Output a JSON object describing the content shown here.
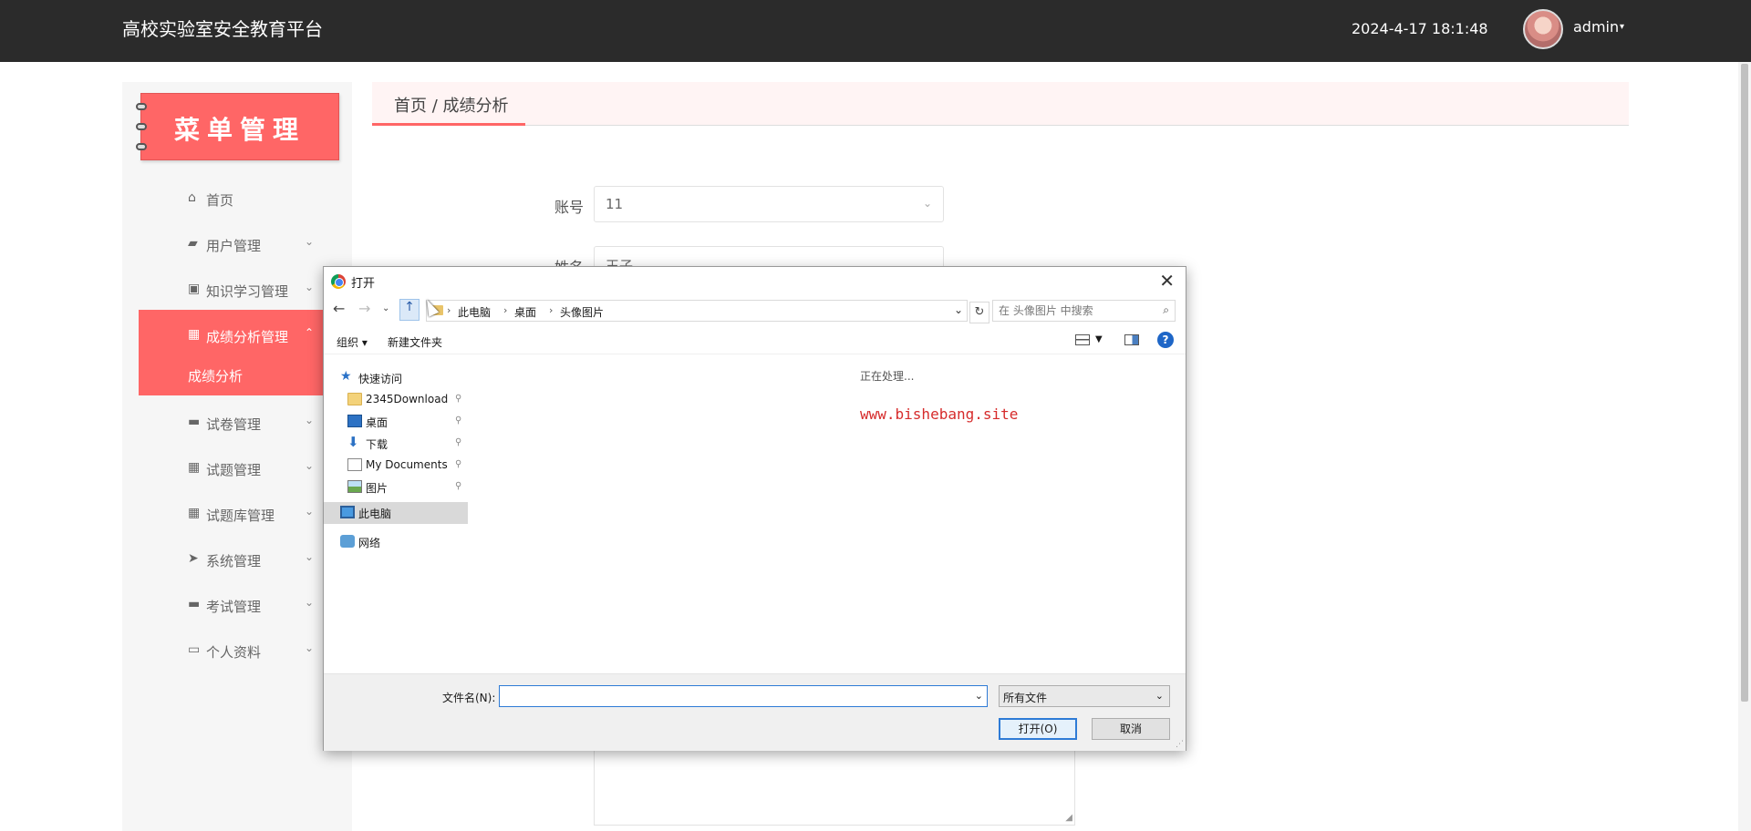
{
  "topbar": {
    "app_title": "高校实验室安全教育平台",
    "clock": "2024-4-17 18:1:48",
    "user_name": "admin",
    "user_caret": "▾"
  },
  "sidebar": {
    "banner": "菜单管理",
    "items": [
      {
        "icon": "home-icon",
        "glyph": "⌂",
        "label": "首页",
        "caret": ""
      },
      {
        "icon": "user-icon",
        "glyph": "▰",
        "label": "用户管理",
        "caret": "⌄"
      },
      {
        "icon": "clipboard-icon",
        "glyph": "▣",
        "label": "知识学习管理",
        "caret": "⌄"
      },
      {
        "icon": "grid-icon",
        "glyph": "▦",
        "label": "成绩分析管理",
        "caret": "⌃",
        "active": true
      },
      {
        "icon": "monitor-icon",
        "glyph": "▬",
        "label": "试卷管理",
        "caret": "⌄"
      },
      {
        "icon": "grid-icon",
        "glyph": "▦",
        "label": "试题管理",
        "caret": "⌄"
      },
      {
        "icon": "grid-icon",
        "glyph": "▦",
        "label": "试题库管理",
        "caret": "⌄"
      },
      {
        "icon": "send-icon",
        "glyph": "➤",
        "label": "系统管理",
        "caret": "⌄"
      },
      {
        "icon": "monitor-icon",
        "glyph": "▬",
        "label": "考试管理",
        "caret": "⌄"
      },
      {
        "icon": "card-icon",
        "glyph": "▭",
        "label": "个人资料",
        "caret": "⌄"
      }
    ],
    "sub_item": "成绩分析"
  },
  "breadcrumb": {
    "text": "首页 / 成绩分析"
  },
  "form": {
    "account_label": "账号",
    "account_value": "11",
    "name_label": "姓名",
    "name_value": "王子"
  },
  "dialog": {
    "title": "打开",
    "close": "✕",
    "path": [
      "此电脑",
      "桌面",
      "头像图片"
    ],
    "search_placeholder": "在 头像图片 中搜索",
    "toolbar": {
      "organize": "组织 ▾",
      "new_folder": "新建文件夹",
      "help": "?"
    },
    "tree": [
      {
        "icon": "star-icon",
        "cls": "star",
        "glyph": "★",
        "label": "快速访问",
        "indent": 22,
        "pinned": false
      },
      {
        "icon": "folder-icon",
        "cls": "folder",
        "glyph": "",
        "label": "2345Download",
        "indent": 30,
        "pinned": true
      },
      {
        "icon": "desktop-icon",
        "cls": "desktop",
        "glyph": "",
        "label": "桌面",
        "indent": 30,
        "pinned": true
      },
      {
        "icon": "download-icon",
        "cls": "download",
        "glyph": "⬇",
        "label": "下载",
        "indent": 30,
        "pinned": true
      },
      {
        "icon": "document-icon",
        "cls": "doc",
        "glyph": "",
        "label": "My Documents",
        "indent": 30,
        "pinned": true
      },
      {
        "icon": "pictures-icon",
        "cls": "pictures",
        "glyph": "",
        "label": "图片",
        "indent": 30,
        "pinned": true
      },
      {
        "icon": "computer-icon",
        "cls": "pc",
        "glyph": "",
        "label": "此电脑",
        "indent": 22,
        "pinned": false,
        "selected": true
      },
      {
        "icon": "network-icon",
        "cls": "net",
        "glyph": "",
        "label": "网络",
        "indent": 22,
        "pinned": false
      }
    ],
    "status": "正在处理...",
    "watermark": "www.bishebang.site",
    "filename_label": "文件名(N):",
    "filename_value": "",
    "filetype": "所有文件",
    "open_button": "打开(O)",
    "cancel_button": "取消"
  }
}
